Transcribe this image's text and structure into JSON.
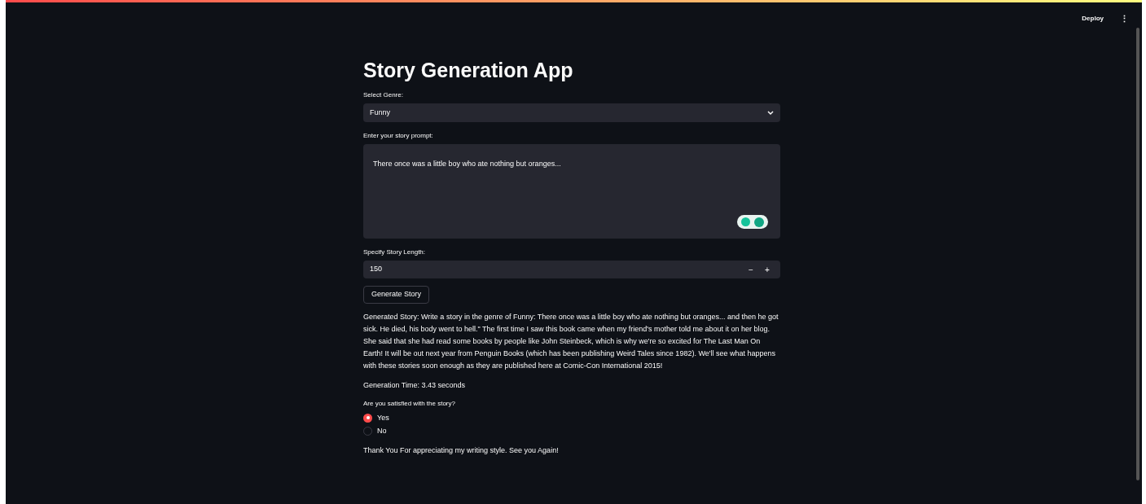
{
  "header": {
    "deploy": "Deploy",
    "menu": "⋮"
  },
  "title": "Story Generation App",
  "genre": {
    "label": "Select Genre:",
    "value": "Funny"
  },
  "prompt": {
    "label": "Enter your story prompt:",
    "value": "There once was a little boy who ate nothing but oranges..."
  },
  "length": {
    "label": "Specify Story Length:",
    "value": "150",
    "minus": "−",
    "plus": "+"
  },
  "generate_button": "Generate Story",
  "story": "Generated Story: Write a story in the genre of Funny: There once was a little boy who ate nothing but oranges... and then he got sick. He died, his body went to hell.\" The first time I saw this book came when my friend's mother told me about it on her blog. She said that she had read some books by people like John Steinbeck, which is why we're so excited for The Last Man On Earth! It will be out next year from Penguin Books (which has been publishing Weird Tales since 1982). We'll see what happens with these stories soon enough as they are published here at Comic-Con International 2015!",
  "generation_time": "Generation Time: 3.43 seconds",
  "satisfaction": {
    "label": "Are you satisfied with the story?",
    "options": [
      {
        "label": "Yes",
        "selected": true
      },
      {
        "label": "No",
        "selected": false
      }
    ]
  },
  "thanks": "Thank You For appreciating my writing style. See you Again!"
}
